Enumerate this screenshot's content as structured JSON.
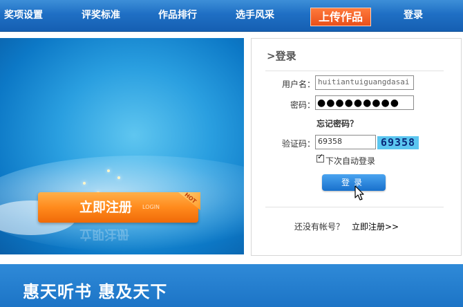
{
  "nav": {
    "items": [
      "奖项设置",
      "评奖标准",
      "作品排行",
      "选手风采"
    ],
    "upload_label": "上传作品",
    "login_label": "登录"
  },
  "banner": {
    "register_label": "立即注册",
    "register_sub": "LOGIN",
    "hot_label": "HOT"
  },
  "login": {
    "title": ">登录",
    "username_label": "用户名：",
    "username_value": "huitiantuiguangdasai",
    "password_label": "密码：",
    "password_mask": "●●●●●●●●●",
    "forgot_label": "忘记密码？",
    "captcha_label": "验证码：",
    "captcha_value": "69358",
    "captcha_image_text": "69358",
    "remember_label": "下次自动登录",
    "remember_checked": true,
    "submit_label": "登录",
    "no_account_text": "还没有帐号？",
    "register_link": "立即注册>>"
  },
  "footer": {
    "slogan": "惠天听书  惠及天下"
  },
  "colors": {
    "nav": "#1f6fc4",
    "upload": "#e9501a",
    "register_button": "#ff8a1c",
    "login_button": "#1870cc",
    "footer": "#1c74c6"
  }
}
